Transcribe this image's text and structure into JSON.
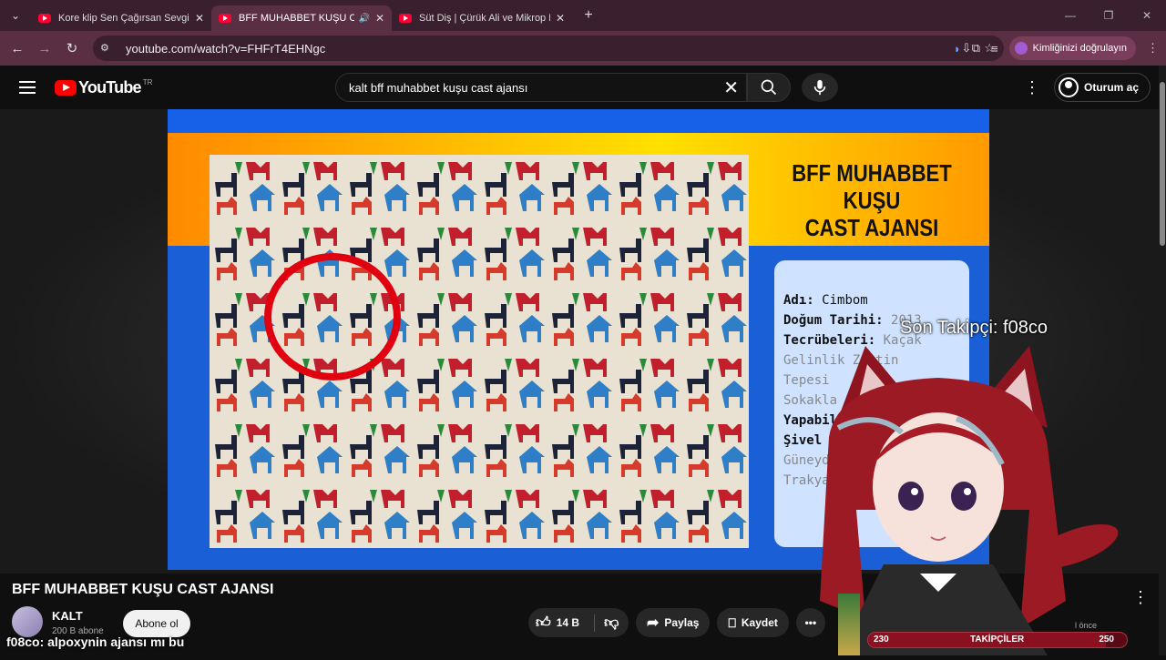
{
  "browser": {
    "tabs": [
      {
        "label": "Kore klip Sen Çağırsan Sevgilim",
        "active": false,
        "audio": false
      },
      {
        "label": "BFF MUHABBET KUŞU CAST AJANSI",
        "active": true,
        "audio": true
      },
      {
        "label": "Süt Diş | Çürük Ali ve Mikrop Nam",
        "active": false,
        "audio": false
      }
    ],
    "url": "youtube.com/watch?v=FHFrT4EHNgc",
    "profile_button": "Kimliğinizi doğrulayın"
  },
  "youtube": {
    "logo_text": "YouTube",
    "logo_region": "TR",
    "search_value": "kalt bff muhabbet kuşu cast ajansı",
    "signin_label": "Oturum aç"
  },
  "video": {
    "card_title_line1": "BFF MUHABBET KUŞU",
    "card_title_line2": "CAST AJANSI",
    "info": {
      "name_label": "Adı:",
      "name_value": "Cimbom",
      "birth_label": "Doğum Tarihi:",
      "birth_value": "2013",
      "exp_label": "Tecrübeleri:",
      "exp_value": "Kaçak",
      "line4": "Gelinlik Zeytin",
      "line5": "Tepesi",
      "line6": "Sokakla",
      "can_label": "Yapabil",
      "shiv_label": "Şivel",
      "line9": "Güneydo",
      "line10": "Trakya"
    },
    "overlay_follower": "Son Takipçi: f08co"
  },
  "meta": {
    "title": "BFF MUHABBET KUŞU CAST AJANSI",
    "channel": "KALT",
    "subscribers": "200 B abone",
    "subscribe_label": "Abone ol",
    "likes": "14 B",
    "share_label": "Paylaş",
    "save_label": "Kaydet"
  },
  "chat": {
    "nick": "f08co",
    "message": ": alpoxynin ajansı mı bu"
  },
  "follow_goal": {
    "label": "TAKİPÇİLER",
    "current": "230",
    "target": "250",
    "fraction": 0.92,
    "ago": "l önce"
  },
  "colors": {
    "tab_bg": "#3a1f2e",
    "toolbar_bg": "#5a2f44",
    "yt_red": "#ff0000",
    "card_blue": "#1a5fd6",
    "circle_red": "#e00010"
  }
}
